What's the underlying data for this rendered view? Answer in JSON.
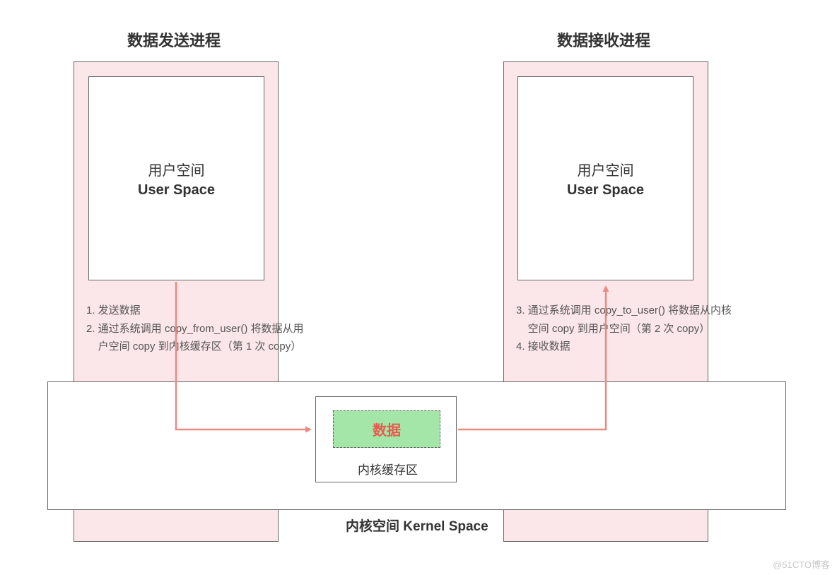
{
  "titles": {
    "sender": "数据发送进程",
    "receiver": "数据接收进程"
  },
  "user_space": {
    "cn": "用户空间",
    "en": "User Space"
  },
  "kernel": {
    "space_label": "内核空间 Kernel Space",
    "buffer_label": "内核缓存区",
    "data_label": "数据"
  },
  "steps_left": {
    "line1": "1. 发送数据",
    "line2": "2. 通过系统调用 copy_from_user() 将数据从用",
    "line3": "    户空间 copy 到内核缓存区（第 1 次 copy）"
  },
  "steps_right": {
    "line1": "3. 通过系统调用 copy_to_user() 将数据从内核",
    "line2": "    空间 copy 到用户空间（第 2 次 copy）",
    "line3": "4. 接收数据"
  },
  "watermark": "@51CTO博客"
}
